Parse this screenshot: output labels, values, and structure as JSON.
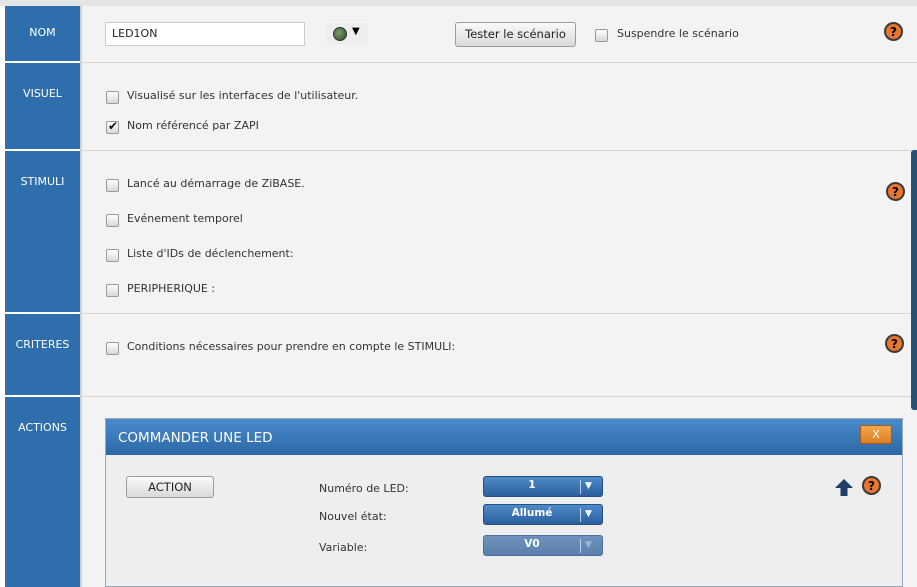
{
  "sidebar": {
    "nom": "NOM",
    "visuel": "VISUEL",
    "stimuli": "STIMULI",
    "criteres": "CRITERES",
    "actions": "ACTIONS"
  },
  "nom_section": {
    "name_value": "LED1ON",
    "icon": "globe-icon",
    "test_button": "Tester le scénario",
    "suspend_label": "Suspendre le scénario",
    "suspend_checked": false
  },
  "visuel_section": {
    "items": [
      {
        "label": "Visualisé sur les interfaces de l'utilisateur.",
        "checked": false
      },
      {
        "label": "Nom référencé par ZAPI",
        "checked": true
      }
    ]
  },
  "stimuli_section": {
    "items": [
      {
        "label": "Lancé au démarrage de ZiBASE.",
        "checked": false
      },
      {
        "label": "Evénement temporel",
        "checked": false
      },
      {
        "label": "Liste d'IDs de déclenchement:",
        "checked": false
      },
      {
        "label": "PERIPHERIQUE :",
        "checked": false
      }
    ]
  },
  "criteres_section": {
    "items": [
      {
        "label": "Conditions nécessaires pour prendre en compte le STIMULI:",
        "checked": false
      }
    ]
  },
  "help_label": "?",
  "action_panel": {
    "title": "COMMANDER UNE LED",
    "close_label": "X",
    "action_button": "ACTION",
    "fields": {
      "led_number": {
        "label": "Numéro de LED:",
        "value": "1"
      },
      "new_state": {
        "label": "Nouvel état:",
        "value": "Allumé"
      },
      "variable": {
        "label": "Variable:",
        "value": "V0"
      }
    }
  },
  "colors": {
    "sidebar": "#2f6eac",
    "panel_header": "#3a7bbd",
    "help": "#e8762d",
    "close": "#e88a2c"
  }
}
